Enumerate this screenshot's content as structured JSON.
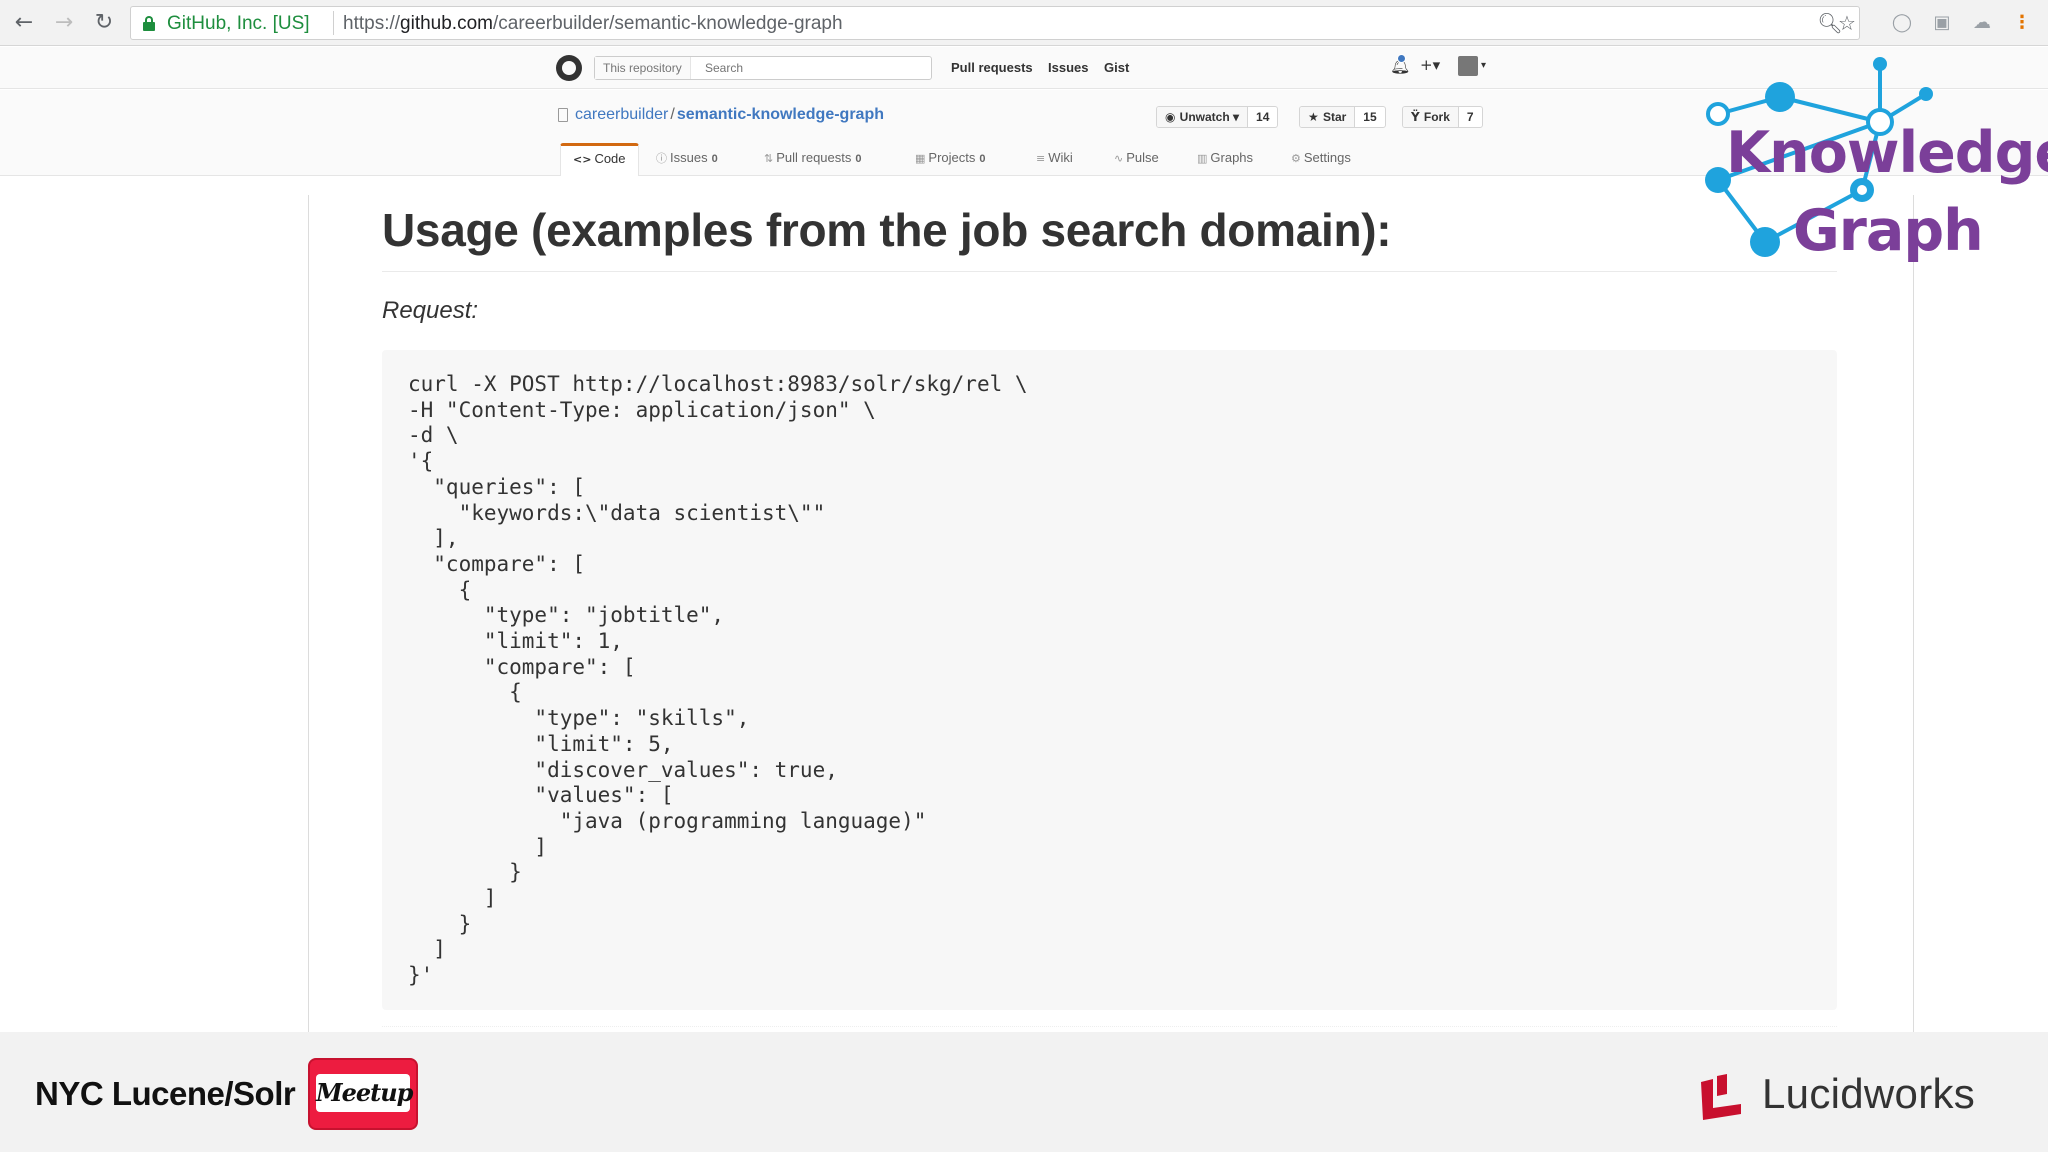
{
  "browser": {
    "ev_label": "GitHub, Inc. [US]",
    "url_scheme": "https://",
    "url_host": "github.com",
    "url_path": "/careerbuilder/semantic-knowledge-graph"
  },
  "gh_header": {
    "scope_label": "This repository",
    "search_placeholder": "Search",
    "links": [
      "Pull requests",
      "Issues",
      "Gist"
    ],
    "plus_label": "+▾"
  },
  "repo": {
    "owner": "careerbuilder",
    "separator": "/",
    "name": "semantic-knowledge-graph",
    "unwatch_label": "Unwatch ▾",
    "unwatch_count": "14",
    "star_label": "Star",
    "star_count": "15",
    "fork_label": "Fork",
    "fork_count": "7"
  },
  "tabs": [
    {
      "icon": "<>",
      "label": "Code",
      "count": ""
    },
    {
      "icon": "ⓘ",
      "label": "Issues",
      "count": "0"
    },
    {
      "icon": "⇅",
      "label": "Pull requests",
      "count": "0"
    },
    {
      "icon": "▦",
      "label": "Projects",
      "count": "0"
    },
    {
      "icon": "≡",
      "label": "Wiki",
      "count": ""
    },
    {
      "icon": "∿",
      "label": "Pulse",
      "count": ""
    },
    {
      "icon": "▥",
      "label": "Graphs",
      "count": ""
    },
    {
      "icon": "⚙",
      "label": "Settings",
      "count": ""
    }
  ],
  "content": {
    "heading": "Usage (examples from the job search domain):",
    "request_label": "Request:",
    "code": "curl -X POST http://localhost:8983/solr/skg/rel \\\n-H \"Content-Type: application/json\" \\\n-d \\\n'{\n  \"queries\": [\n    \"keywords:\\\"data scientist\\\"\"\n  ],\n  \"compare\": [\n    {\n      \"type\": \"jobtitle\",\n      \"limit\": 1,\n      \"compare\": [\n        {\n          \"type\": \"skills\",\n          \"limit\": 5,\n          \"discover_values\": true,\n          \"values\": [\n            \"java (programming language)\"\n          ]\n        }\n      ]\n    }\n  ]\n}'"
  },
  "overlay": {
    "word1": "Knowledge",
    "word2": "Graph"
  },
  "footer": {
    "left_text": "NYC Lucene/Solr",
    "meetup_text": "Meetup",
    "right_text": "Lucidworks"
  },
  "colors": {
    "kg_purple": "#7b3f99",
    "kg_blue": "#1fa3dd",
    "meetup_red": "#ed1c40",
    "lucidworks_red": "#c8102e",
    "github_blue": "#4078c0",
    "tab_accent": "#d26911"
  },
  "icons": [
    "back-icon",
    "forward-icon",
    "reload-icon",
    "lock-icon",
    "zoom-icon",
    "star-icon",
    "menu-icon",
    "github-logo-icon",
    "bell-icon",
    "eye-icon",
    "fork-icon",
    "repo-icon"
  ]
}
